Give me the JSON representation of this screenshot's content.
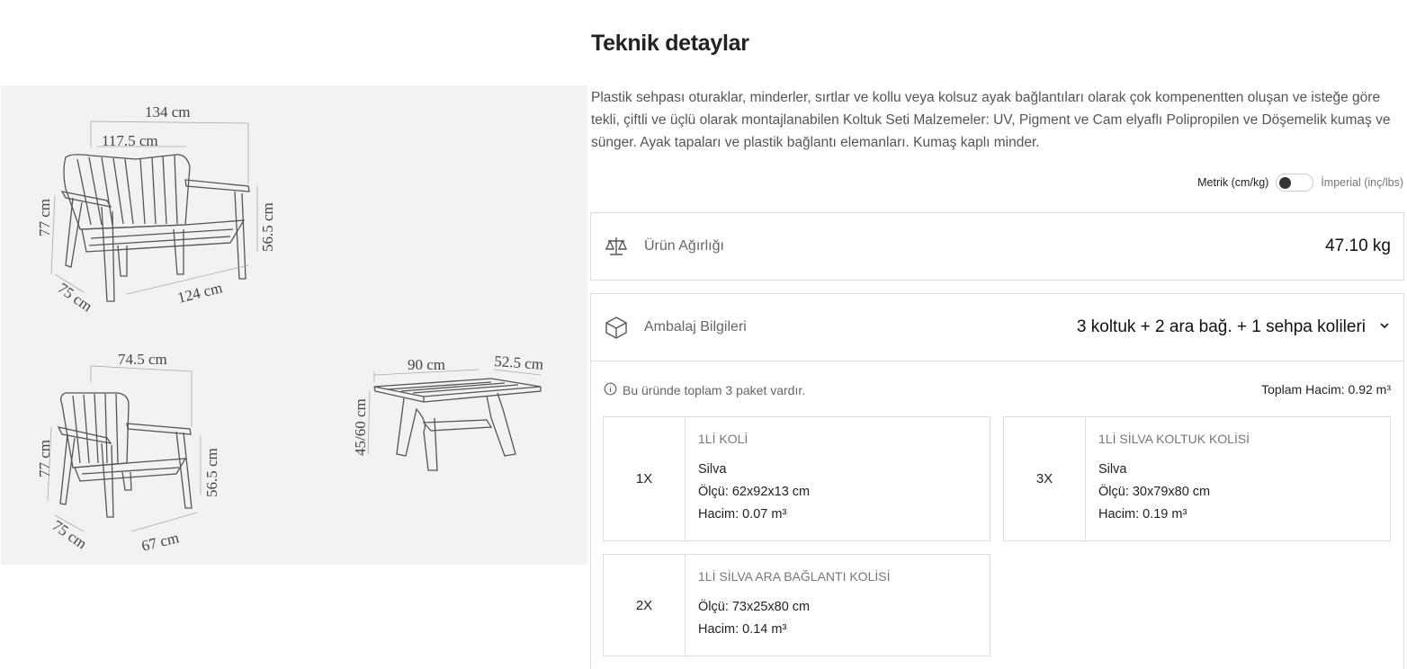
{
  "page_title": "Teknik detaylar",
  "description": "Plastik sehpası oturaklar, minderler, sırtlar ve kollu veya kolsuz ayak bağlantıları olarak çok kompenentten oluşan ve isteğe göre tekli, çiftli ve üçlü olarak montajlanabilen Koltuk Seti Malzemeler: UV, Pigment ve Cam elyaflı Polipropilen ve Döşemelik kumaş ve sünger. Ayak tapaları ve plastik bağlantı elemanları. Kumaş kaplı minder.",
  "drawing": {
    "sofa": {
      "total_width": "134 cm",
      "seat_width": "117.5 cm",
      "height": "77 cm",
      "arm_height": "56.5 cm",
      "depth": "75 cm",
      "base_width": "124 cm"
    },
    "chair": {
      "width": "74.5 cm",
      "height": "77 cm",
      "arm_height": "56.5 cm",
      "depth": "75 cm",
      "base_width": "67 cm"
    },
    "table": {
      "length": "90 cm",
      "width": "52.5 cm",
      "height": "45/60 cm"
    }
  },
  "units": {
    "metric": "Metrik (cm/kg)",
    "imperial": "İmperial (inç/lbs)",
    "selected": "metric"
  },
  "weight": {
    "label": "Ürün Ağırlığı",
    "value": "47.10 kg",
    "icon": "scale-icon"
  },
  "packaging": {
    "label": "Ambalaj Bilgileri",
    "icon": "box-icon",
    "summary": "3 koltuk + 2 ara bağ. + 1 sehpa kolileri",
    "info": "Bu üründe toplam 3 paket vardır.",
    "total_volume": "Toplam Hacim: 0.92 m³",
    "packages": [
      {
        "qty": "1X",
        "name": "1Lİ KOLİ",
        "model": "Silva",
        "size": "Ölçü: 62x92x13 cm",
        "volume": "Hacim: 0.07 m³"
      },
      {
        "qty": "3X",
        "name": "1Lİ SİLVA KOLTUK KOLİSİ",
        "model": "Silva",
        "size": "Ölçü: 30x79x80 cm",
        "volume": "Hacim: 0.19 m³"
      },
      {
        "qty": "2X",
        "name": "1Lİ SİLVA ARA BAĞLANTI KOLİSİ",
        "size": "Ölçü: 73x25x80 cm",
        "volume": "Hacim: 0.14 m³"
      }
    ]
  }
}
